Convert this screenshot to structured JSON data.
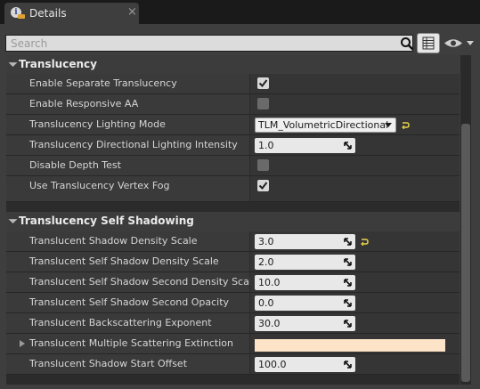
{
  "tab": {
    "title": "Details",
    "close": "×"
  },
  "search": {
    "placeholder": "Search"
  },
  "categories": [
    {
      "title": "Translucency",
      "rows": [
        {
          "label": "Enable Separate Translucency",
          "type": "checkbox",
          "checked": true
        },
        {
          "label": "Enable Responsive AA",
          "type": "checkbox",
          "checked": false
        },
        {
          "label": "Translucency Lighting Mode",
          "type": "dropdown",
          "value": "TLM_VolumetricDirectional",
          "reset": true
        },
        {
          "label": "Translucency Directional Lighting Intensity",
          "type": "number",
          "value": "1.0"
        },
        {
          "label": "Disable Depth Test",
          "type": "checkbox",
          "checked": false
        },
        {
          "label": "Use Translucency Vertex Fog",
          "type": "checkbox",
          "checked": true
        }
      ]
    },
    {
      "title": "Translucency Self Shadowing",
      "rows": [
        {
          "label": "Translucent Shadow Density Scale",
          "type": "number",
          "value": "3.0",
          "reset": true
        },
        {
          "label": "Translucent Self Shadow Density Scale",
          "type": "number",
          "value": "2.0"
        },
        {
          "label": "Translucent Self Shadow Second Density Scale",
          "type": "number",
          "value": "10.0"
        },
        {
          "label": "Translucent Self Shadow Second Opacity",
          "type": "number",
          "value": "0.0"
        },
        {
          "label": "Translucent Backscattering Exponent",
          "type": "number",
          "value": "30.0"
        },
        {
          "label": "Translucent Multiple Scattering Extinction",
          "type": "color",
          "color": "#fde4c8",
          "expandable": true
        },
        {
          "label": "Translucent Shadow Start Offset",
          "type": "number",
          "value": "100.0"
        }
      ]
    }
  ],
  "colors": {
    "accent_reset": "#e8d44a",
    "panel": "#3e3e3e"
  }
}
